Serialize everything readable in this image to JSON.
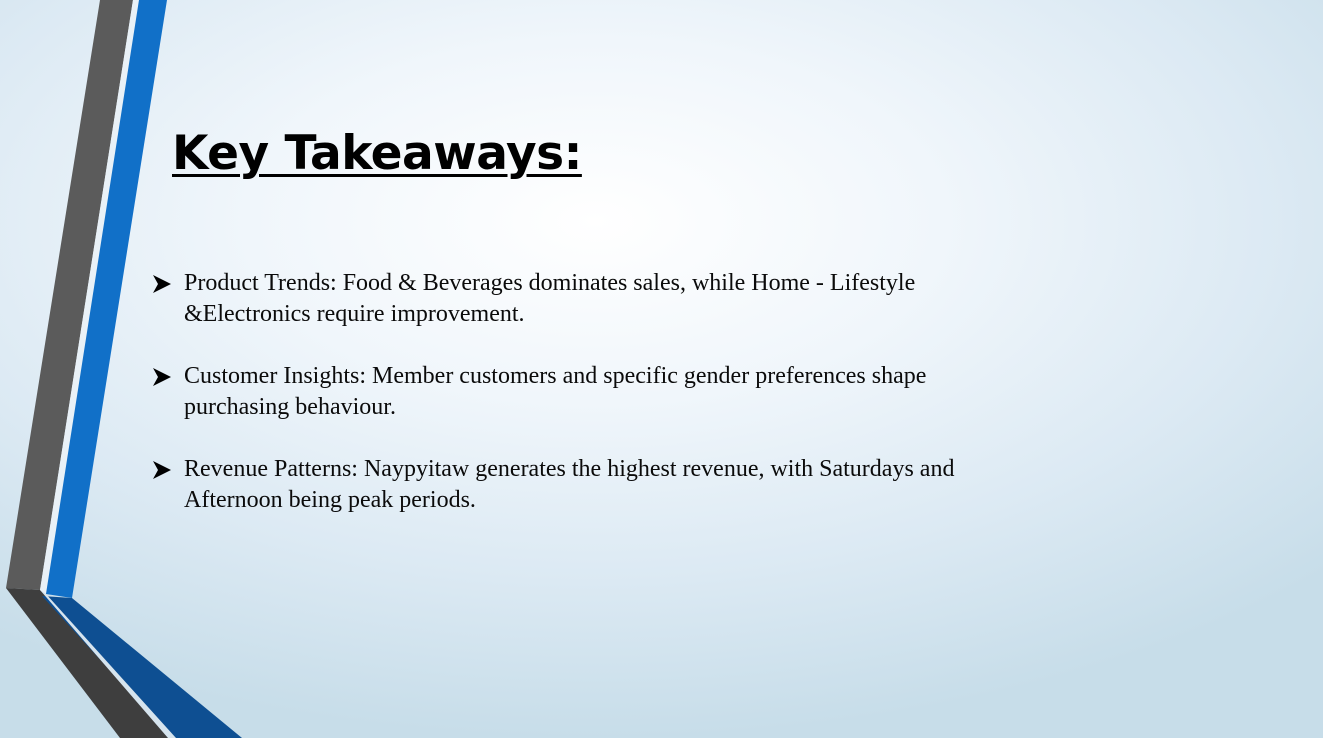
{
  "slide": {
    "title": "Key Takeaways:",
    "bullets": [
      {
        "text": "Product Trends: Food & Beverages dominates sales, while Home - Lifestyle &Electronics require improvement.",
        "icon": "arrow-bullet-icon"
      },
      {
        "text": "Customer Insights: Member customers and specific gender preferences shape purchasing behaviour.",
        "icon": "arrow-bullet-icon"
      },
      {
        "text": "Revenue Patterns: Naypyitaw generates the highest revenue, with Saturdays and Afternoon being peak periods.",
        "icon": "arrow-bullet-icon"
      }
    ]
  },
  "colors": {
    "stripe_gray": "#5a5a5a",
    "stripe_blue": "#1170c8",
    "stripe_dark_blue": "#0e4f92",
    "title": "#000000",
    "body_text": "#0b0b0b"
  }
}
